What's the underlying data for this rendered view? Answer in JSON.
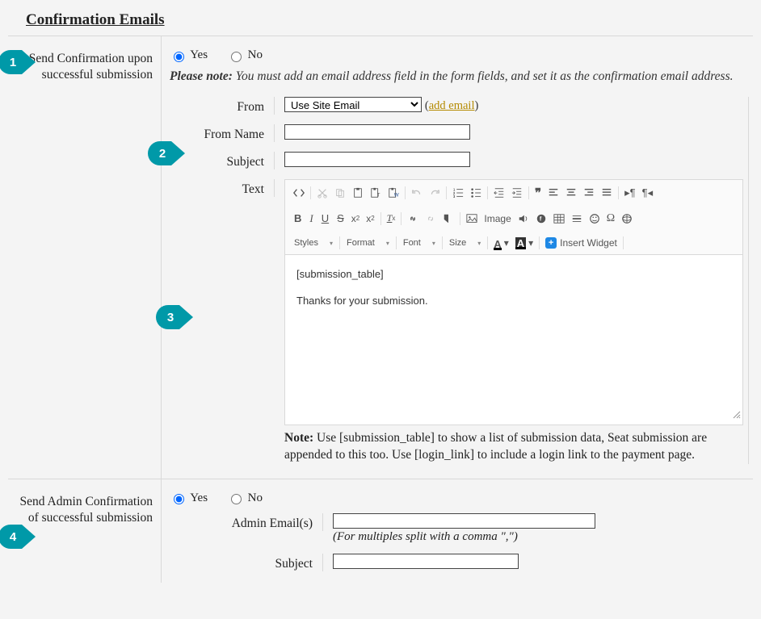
{
  "section_title": "Confirmation Emails",
  "markers": [
    "1",
    "2",
    "3",
    "4"
  ],
  "send_conf": {
    "label": "Send Confirmation upon successful submission",
    "yes": "Yes",
    "no": "No",
    "note_b": "Please note:",
    "note": "You must add an email address field in the form fields, and set it as the confirmation email address."
  },
  "fields": {
    "from_label": "From",
    "from_select": "Use Site Email",
    "add_email": "add email",
    "from_name_label": "From Name",
    "subject_label": "Subject",
    "text_label": "Text"
  },
  "editor": {
    "image_label": "Image",
    "dd_styles": "Styles",
    "dd_format": "Format",
    "dd_font": "Font",
    "dd_size": "Size",
    "insert_widget": "Insert Widget",
    "body_line1": "[submission_table]",
    "body_line2": "Thanks for your submission.",
    "note_b": "Note:",
    "note": "Use [submission_table] to show a list of submission data, Seat submission are appended to this too. Use [login_link] to include a login link to the payment page."
  },
  "admin": {
    "label": "Send Admin Confirmation of successful submission",
    "yes": "Yes",
    "no": "No",
    "emails_label": "Admin Email(s)",
    "emails_hint": "(For multiples split with a comma \",\")",
    "subject_label": "Subject"
  }
}
